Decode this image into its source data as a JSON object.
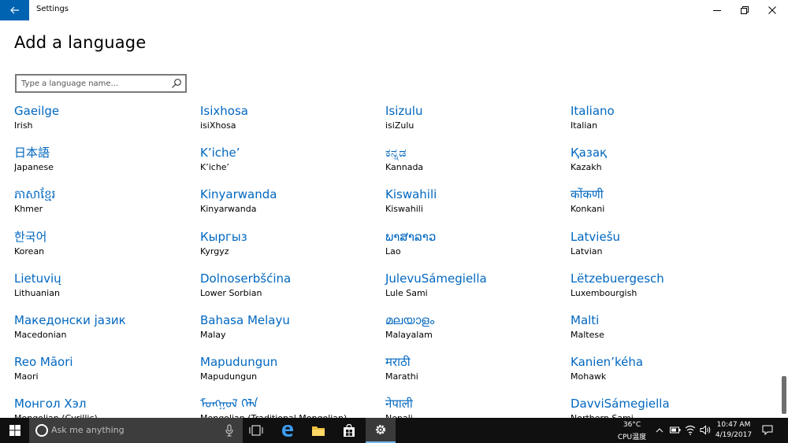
{
  "window": {
    "title": "Settings",
    "page_title": "Add a language"
  },
  "search": {
    "placeholder": "Type a language name...",
    "value": ""
  },
  "languages": [
    {
      "native": "Gaeilge",
      "english": "Irish"
    },
    {
      "native": "Isixhosa",
      "english": "isiXhosa"
    },
    {
      "native": "Isizulu",
      "english": "isiZulu"
    },
    {
      "native": "Italiano",
      "english": "Italian"
    },
    {
      "native": "日本語",
      "english": "Japanese"
    },
    {
      "native": "K’iche’",
      "english": "K’iche’"
    },
    {
      "native": "ಕನ್ನಡ",
      "english": "Kannada"
    },
    {
      "native": "Қазақ",
      "english": "Kazakh"
    },
    {
      "native": "ភាសាខ្មែរ",
      "english": "Khmer"
    },
    {
      "native": "Kinyarwanda",
      "english": "Kinyarwanda"
    },
    {
      "native": "Kiswahili",
      "english": "Kiswahili"
    },
    {
      "native": "कोंकणी",
      "english": "Konkani"
    },
    {
      "native": "한국어",
      "english": "Korean"
    },
    {
      "native": "Кыргыз",
      "english": "Kyrgyz"
    },
    {
      "native": "ພາສາລາວ",
      "english": "Lao"
    },
    {
      "native": "Latviešu",
      "english": "Latvian"
    },
    {
      "native": "Lietuvių",
      "english": "Lithuanian"
    },
    {
      "native": "Dolnoserbšćina",
      "english": "Lower Sorbian"
    },
    {
      "native": "JulevuSámegiella",
      "english": "Lule Sami"
    },
    {
      "native": "Lëtzebuergesch",
      "english": "Luxembourgish"
    },
    {
      "native": "Македонски јазик",
      "english": "Macedonian"
    },
    {
      "native": "Bahasa Melayu",
      "english": "Malay"
    },
    {
      "native": "മലയാളം",
      "english": "Malayalam"
    },
    {
      "native": "Malti",
      "english": "Maltese"
    },
    {
      "native": "Reo Māori",
      "english": "Maori"
    },
    {
      "native": "Mapudungun",
      "english": "Mapudungun"
    },
    {
      "native": "मराठी",
      "english": "Marathi"
    },
    {
      "native": "Kanien’kéha",
      "english": "Mohawk"
    },
    {
      "native": "Монгол Хэл",
      "english": "Mongolian (Cyrillic)"
    },
    {
      "native": "ᠮᠣᠩᠭᠣᠯ ᠬᠡᠯᠡ",
      "english": "Mongolian (Traditional Mongolian)"
    },
    {
      "native": "नेपाली",
      "english": "Nepali"
    },
    {
      "native": "DavviSámegiella",
      "english": "Northern Sami"
    }
  ],
  "taskbar": {
    "search_placeholder": "Ask me anything",
    "temperature": "36°C",
    "cpu_label": "CPU温度",
    "time": "10:47 AM",
    "date": "4/19/2017"
  },
  "icons": {
    "back": "back-arrow-icon",
    "search": "search-icon",
    "minimize": "minimize-icon",
    "restore": "restore-icon",
    "close": "close-icon"
  },
  "colors": {
    "accent": "#0063b1",
    "link": "#0067c0",
    "taskbar": "#101010"
  }
}
